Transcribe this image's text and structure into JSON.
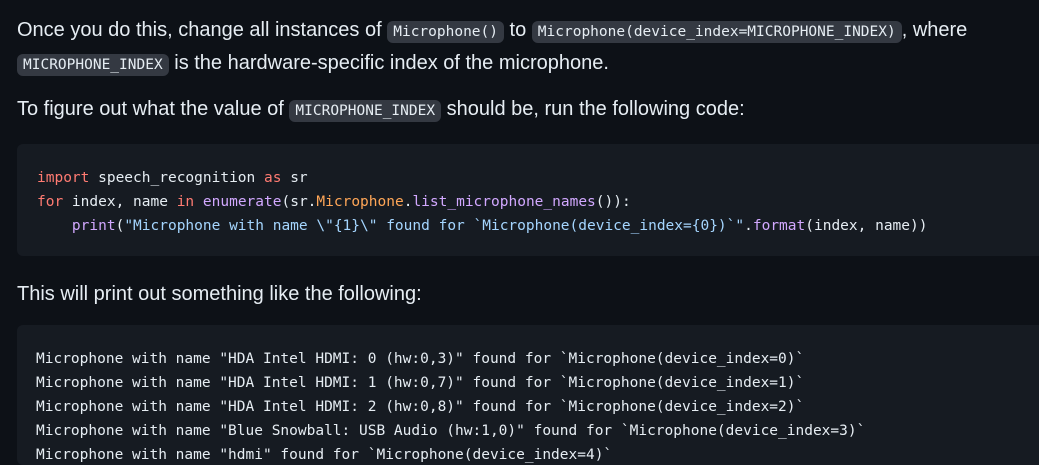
{
  "para1": {
    "t1": "Once you do this, change all instances of ",
    "c1": "Microphone()",
    "t2": " to ",
    "c2": "Microphone(device_index=MICROPHONE_INDEX)",
    "t3": ", where ",
    "c3": "MICROPHONE_INDEX",
    "t4": " is the hardware-specific index of the microphone."
  },
  "para2": {
    "t1": "To figure out what the value of ",
    "c1": "MICROPHONE_INDEX",
    "t2": " should be, run the following code:"
  },
  "code1": {
    "l1": {
      "kw1": "import",
      "p1": " speech_recognition ",
      "kw2": "as",
      "p2": " sr"
    },
    "l2": {
      "kw1": "for",
      "p1": " index, name ",
      "kw2": "in",
      "p2": " ",
      "fn1": "enumerate",
      "p3": "(sr.",
      "cls1": "Microphone",
      "p4": ".",
      "fn2": "list_microphone_names",
      "p5": "()):"
    },
    "l3": {
      "indent": "    ",
      "fn1": "print",
      "p1": "(",
      "s1": "\"Microphone with name \\\"{1}\\\" found for `Microphone(device_index={0})`\"",
      "p2": ".",
      "fn2": "format",
      "p3": "(index, name))"
    }
  },
  "para3": {
    "t1": "This will print out something like the following:"
  },
  "output": {
    "lines": [
      "Microphone with name \"HDA Intel HDMI: 0 (hw:0,3)\" found for `Microphone(device_index=0)`",
      "Microphone with name \"HDA Intel HDMI: 1 (hw:0,7)\" found for `Microphone(device_index=1)`",
      "Microphone with name \"HDA Intel HDMI: 2 (hw:0,8)\" found for `Microphone(device_index=2)`",
      "Microphone with name \"Blue Snowball: USB Audio (hw:1,0)\" found for `Microphone(device_index=3)`",
      "Microphone with name \"hdmi\" found for `Microphone(device_index=4)`"
    ]
  },
  "colors": {
    "background": "#0d1117",
    "code_background": "#161b22",
    "inline_code_background": "#343942",
    "keyword": "#ff7b72",
    "function": "#d2a8ff",
    "class": "#ffa657",
    "string": "#a5d6ff",
    "text": "#e6edf3"
  }
}
